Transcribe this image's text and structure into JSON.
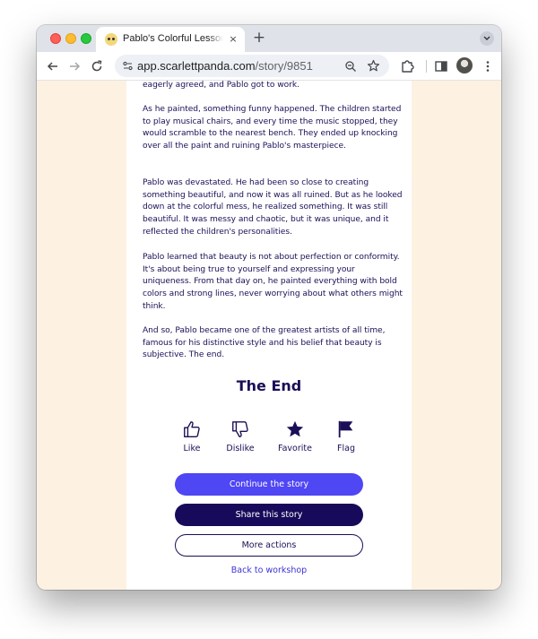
{
  "browser": {
    "tab_title": "Pablo's Colorful Lesson: Beauty is Subjective",
    "tab_close": "×",
    "new_tab": "+",
    "url_host": "app.scarlettpanda.com",
    "url_path": "/story/9851"
  },
  "story": {
    "paragraphs": [
      "eagerly agreed, and Pablo got to work.",
      "As he painted, something funny happened. The children started to play musical chairs, and every time the music stopped, they would scramble to the nearest bench. They ended up knocking over all the paint and ruining Pablo's masterpiece.",
      "Pablo was devastated. He had been so close to creating something beautiful, and now it was all ruined. But as he looked down at the colorful mess, he realized something. It was still beautiful. It was messy and chaotic, but it was unique, and it reflected the children's personalities.",
      "Pablo learned that beauty is not about perfection or conformity. It's about being true to yourself and expressing your uniqueness. From that day on, he painted everything with bold colors and strong lines, never worrying about what others might think.",
      "And so, Pablo became one of the greatest artists of all time, famous for his distinctive style and his belief that beauty is subjective. The end."
    ],
    "end_title": "The End"
  },
  "reactions": {
    "like": "Like",
    "dislike": "Dislike",
    "favorite": "Favorite",
    "flag": "Flag"
  },
  "actions": {
    "continue": "Continue the story",
    "share": "Share this story",
    "more": "More actions",
    "back": "Back to workshop"
  },
  "colors": {
    "page_background": "#fdf1e2",
    "text_navy": "#1a0f57",
    "primary_button": "#4f46f4",
    "dark_button": "#180a5a",
    "link": "#3b33d6"
  }
}
